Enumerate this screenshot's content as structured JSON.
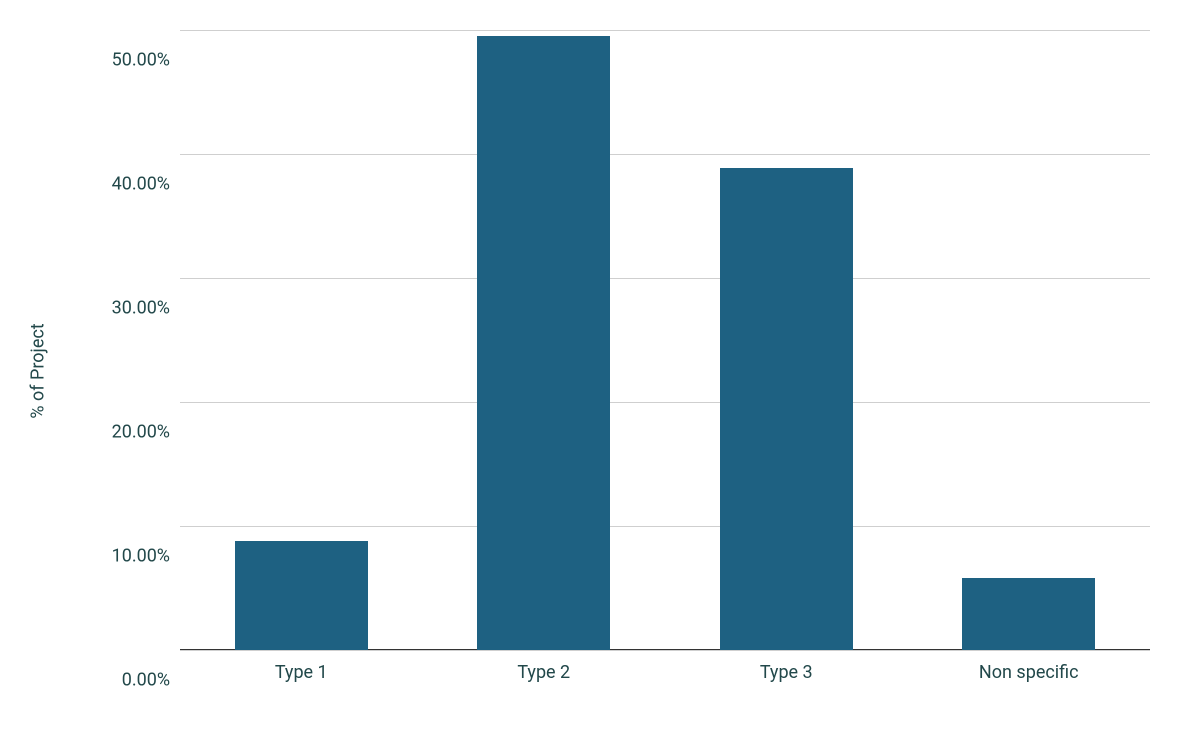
{
  "chart_data": {
    "type": "bar",
    "categories": [
      "Type 1",
      "Type 2",
      "Type 3",
      "Non specific"
    ],
    "values": [
      8.8,
      49.5,
      38.9,
      5.8
    ],
    "title": "",
    "xlabel": "",
    "ylabel": "% of Project",
    "ylim": [
      0,
      50
    ],
    "yticks": [
      0,
      10,
      20,
      30,
      40,
      50
    ],
    "ytick_labels": [
      "0.00%",
      "10.00%",
      "20.00%",
      "30.00%",
      "40.00%",
      "50.00%"
    ],
    "bar_color": "#1e6182"
  }
}
